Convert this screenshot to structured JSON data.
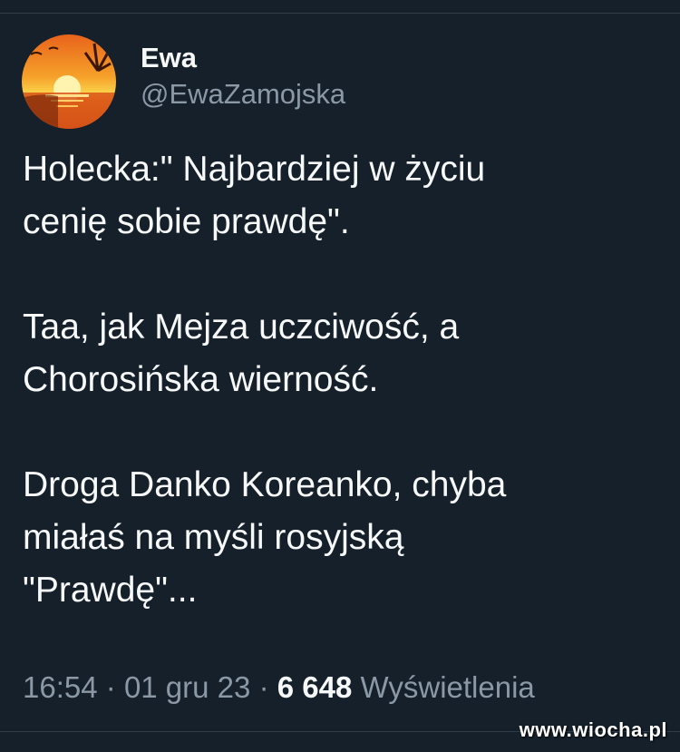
{
  "author": {
    "display_name": "Ewa",
    "handle": "@EwaZamojska",
    "avatar": "sunset-avatar"
  },
  "tweet": {
    "paragraphs": [
      [
        "Holecka:\" Najbardziej w życiu",
        "cenię sobie prawdę\"."
      ],
      [
        "Taa, jak Mejza uczciwość, a",
        "Chorosińska wierność."
      ],
      [
        "Droga Danko Koreanko, chyba",
        "miałaś na myśli rosyjską",
        "\"Prawdę\"..."
      ]
    ]
  },
  "meta": {
    "time": "16:54",
    "separator": "·",
    "date": "01 gru 23",
    "views_count": "6 648",
    "views_label": "Wyświetlenia"
  },
  "watermark": "www.wiocha.pl"
}
